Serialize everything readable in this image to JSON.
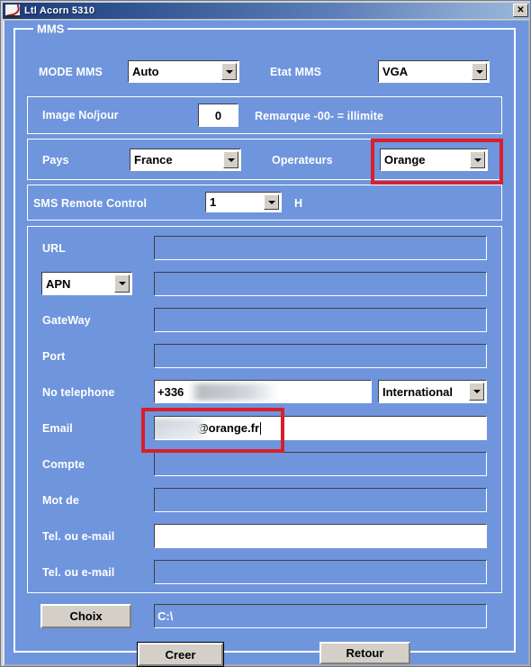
{
  "window": {
    "title": "Ltl Acorn 5310",
    "icon": "app-logo-icon",
    "close_label": "✕"
  },
  "group": {
    "legend": "MMS"
  },
  "row_mode": {
    "mode_label": "MODE MMS",
    "mode_value": "Auto",
    "etat_label": "Etat MMS",
    "etat_value": "VGA"
  },
  "row_image": {
    "label": "Image No/jour",
    "value": "0",
    "remark": "Remarque -00- = illimite"
  },
  "row_pays": {
    "pays_label": "Pays",
    "pays_value": "France",
    "operateurs_label": "Operateurs",
    "operateurs_value": "Orange"
  },
  "row_sms": {
    "label": "SMS Remote Control",
    "value": "1",
    "unit": "H"
  },
  "fields": {
    "url_label": "URL",
    "url_value": "",
    "apn_label": "APN",
    "apn_value": "",
    "gateway_label": "GateWay",
    "gateway_value": "",
    "port_label": "Port",
    "port_value": "",
    "phone_label": "No telephone",
    "phone_value": "+336",
    "phone_type": "International",
    "email_label": "Email",
    "email_value": "@orange.fr",
    "compte_label": "Compte",
    "compte_value": "",
    "motde_label": "Mot de",
    "motde_value": "",
    "tel1_label": "Tel. ou e-mail",
    "tel1_value": "",
    "tel2_label": "Tel. ou e-mail",
    "tel2_value": ""
  },
  "bottom": {
    "choix_label": "Choix",
    "path_value": "C:\\",
    "creer_label": "Creer",
    "retour_label": "Retour"
  },
  "colors": {
    "form_blue": "#6f95dd",
    "title_dark": "#1c3a78",
    "title_light": "#9ab6dc",
    "annotation_red": "#d81f2a",
    "button_face": "#d4d0c8"
  }
}
